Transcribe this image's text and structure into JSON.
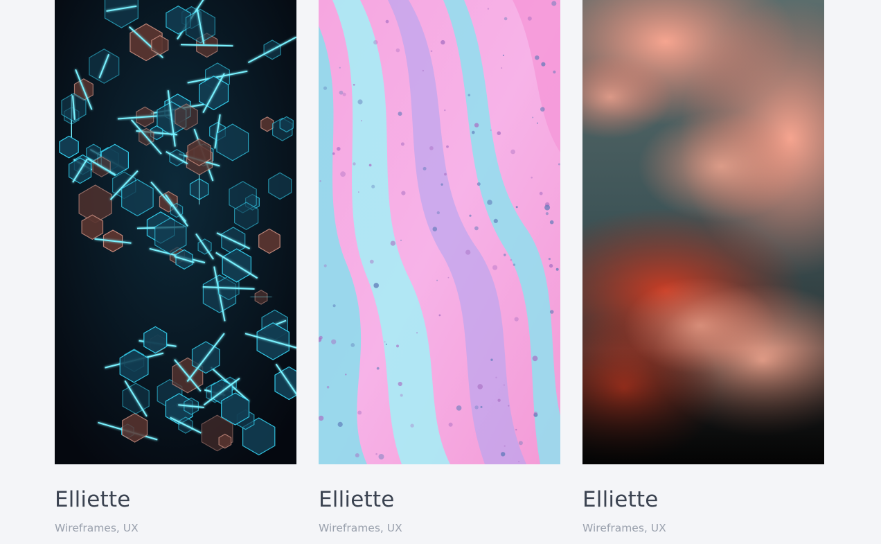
{
  "portfolio": {
    "items": [
      {
        "title": "Elliette",
        "meta": "Wireframes, UX",
        "image": "neon-hexagons-artwork"
      },
      {
        "title": "Elliette",
        "meta": "Wireframes, UX",
        "image": "fluid-paint-marble-artwork"
      },
      {
        "title": "Elliette",
        "meta": "Wireframes, UX",
        "image": "sunset-clouds-photo"
      }
    ]
  },
  "colors": {
    "background": "#f4f5f8",
    "title": "#3b4351",
    "meta": "#9aa1ad"
  }
}
